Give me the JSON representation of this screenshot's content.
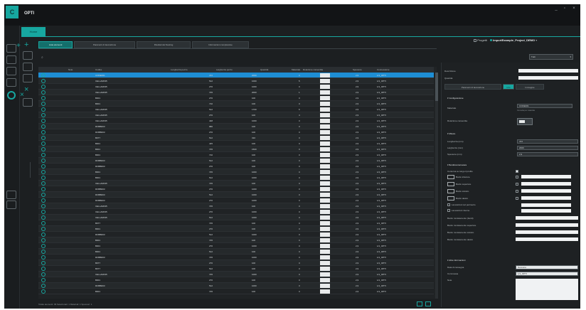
{
  "window": {
    "title": "OPTI",
    "logo_letter": "C",
    "controls": [
      "_",
      "▫",
      "×"
    ]
  },
  "ribbon": {
    "active_tab": "Home"
  },
  "project": {
    "checkbox_label": "Progetti",
    "name": "ImportExample_Project_DEMO"
  },
  "tabs": [
    {
      "label": "Lista elementi",
      "active": true
    },
    {
      "label": "Parametri di lavorazione",
      "active": false
    },
    {
      "label": "Risultati del Nesting",
      "active": false
    },
    {
      "label": "Informazioni complessive",
      "active": false
    }
  ],
  "filter": {
    "selected": "Tutti"
  },
  "table": {
    "columns": [
      "",
      "Note",
      "Codice",
      "Lunghezza pezzo",
      "Larghezza pezzo",
      "Quantità",
      "Materiale",
      "Rotazione consentita",
      "Spessore",
      "Connessione"
    ],
    "rows": [
      {
        "code": "CODE001",
        "len": "472",
        "wid": "2000",
        "qty": "3",
        "thk": "2,9",
        "conn": "1/1_OPTI"
      },
      {
        "code": "CELLAR035",
        "len": "512",
        "wid": "1000",
        "qty": "5",
        "thk": "2,9",
        "conn": "1/1_OPTI"
      },
      {
        "code": "CELLAR035",
        "len": "270",
        "wid": "1000",
        "qty": "3",
        "thk": "2,9",
        "conn": "1/1_OPTI"
      },
      {
        "code": "CELLAR035",
        "len": "745",
        "wid": "2000",
        "qty": "1",
        "thk": "2,9",
        "conn": "1/1_OPTI"
      },
      {
        "code": "B001",
        "len": "270",
        "wid": "100",
        "qty": "3",
        "thk": "2,9",
        "conn": "1/1_OPTI"
      },
      {
        "code": "B001",
        "len": "710",
        "wid": "100",
        "qty": "3",
        "thk": "2,9",
        "conn": "1/1_OPTI"
      },
      {
        "code": "CELLAR035",
        "len": "512",
        "wid": "1700",
        "qty": "6",
        "thk": "2,9",
        "conn": "1/1_OPTI"
      },
      {
        "code": "CELLAR035",
        "len": "270",
        "wid": "100",
        "qty": "4",
        "thk": "2,9",
        "conn": "1/1_OPTI"
      },
      {
        "code": "CELLAR035",
        "len": "448",
        "wid": "1000",
        "qty": "3",
        "thk": "2,9",
        "conn": "1/1_OPTI"
      },
      {
        "code": "ROBB003",
        "len": "980",
        "wid": "100",
        "qty": "3",
        "thk": "2,9",
        "conn": "1/1_OPTI"
      },
      {
        "code": "ROBB003",
        "len": "270",
        "wid": "100",
        "qty": "3",
        "thk": "2,9",
        "conn": "1/1_OPTI"
      },
      {
        "code": "B077",
        "len": "512",
        "wid": "310",
        "qty": "3",
        "thk": "2,9",
        "conn": "1/1_OPTI"
      },
      {
        "code": "B001",
        "len": "445",
        "wid": "100",
        "qty": "3",
        "thk": "2,9",
        "conn": "1/1_OPTI"
      },
      {
        "code": "B001",
        "len": "745",
        "wid": "1500",
        "qty": "3",
        "thk": "2,9",
        "conn": "1/1_OPTI"
      },
      {
        "code": "B001",
        "len": "710",
        "wid": "100",
        "qty": "3",
        "thk": "2,9",
        "conn": "1/1_OPTI"
      },
      {
        "code": "ROBB003",
        "len": "512",
        "wid": "100",
        "qty": "3",
        "thk": "2,9",
        "conn": "1/1_OPTI"
      },
      {
        "code": "ROBB003",
        "len": "270",
        "wid": "100",
        "qty": "3",
        "thk": "2,9",
        "conn": "1/1_OPTI"
      },
      {
        "code": "B001",
        "len": "745",
        "wid": "1000",
        "qty": "3",
        "thk": "2,9",
        "conn": "1/1_OPTI"
      },
      {
        "code": "B001",
        "len": "512",
        "wid": "1000",
        "qty": "3",
        "thk": "2,9",
        "conn": "1/1_OPTI"
      },
      {
        "code": "CELLAR035",
        "len": "745",
        "wid": "100",
        "qty": "3",
        "thk": "2,9",
        "conn": "1/1_OPTI"
      },
      {
        "code": "ROBB003",
        "len": "270",
        "wid": "1000",
        "qty": "3",
        "thk": "2,9",
        "conn": "1/1_OPTI"
      },
      {
        "code": "ROBB003",
        "len": "512",
        "wid": "1000",
        "qty": "3",
        "thk": "2,9",
        "conn": "1/1_OPTI"
      },
      {
        "code": "ROBB003",
        "len": "270",
        "wid": "1000",
        "qty": "3",
        "thk": "2,9",
        "conn": "1/1_OPTI"
      },
      {
        "code": "CELLAR035",
        "len": "745",
        "wid": "100",
        "qty": "3",
        "thk": "2,9",
        "conn": "1/1_OPTI"
      },
      {
        "code": "CELLAR035",
        "len": "270",
        "wid": "1000",
        "qty": "3",
        "thk": "2,9",
        "conn": "1/1_OPTI"
      },
      {
        "code": "CELLAR035",
        "len": "512",
        "wid": "1000",
        "qty": "3",
        "thk": "2,9",
        "conn": "1/1_OPTI"
      },
      {
        "code": "B077",
        "len": "745",
        "wid": "100",
        "qty": "3",
        "thk": "2,9",
        "conn": "1/1_OPTI"
      },
      {
        "code": "B001",
        "len": "270",
        "wid": "100",
        "qty": "3",
        "thk": "2,9",
        "conn": "1/1_OPTI"
      },
      {
        "code": "ROBB003",
        "len": "512",
        "wid": "1000",
        "qty": "3",
        "thk": "2,9",
        "conn": "1/1_OPTI"
      },
      {
        "code": "B001",
        "len": "745",
        "wid": "100",
        "qty": "3",
        "thk": "2,9",
        "conn": "1/1_OPTI"
      },
      {
        "code": "B001",
        "len": "270",
        "wid": "1000",
        "qty": "3",
        "thk": "2,9",
        "conn": "1/1_OPTI"
      },
      {
        "code": "B001",
        "len": "512",
        "wid": "100",
        "qty": "3",
        "thk": "2,9",
        "conn": "1/1_OPTI"
      },
      {
        "code": "ROBB003",
        "len": "745",
        "wid": "1000",
        "qty": "3",
        "thk": "2,9",
        "conn": "1/1_OPTI"
      },
      {
        "code": "B077",
        "len": "270",
        "wid": "100",
        "qty": "3",
        "thk": "2,9",
        "conn": "1/1_OPTI"
      },
      {
        "code": "B077",
        "len": "512",
        "wid": "100",
        "qty": "3",
        "thk": "2,9",
        "conn": "1/1_OPTI"
      },
      {
        "code": "CELLAR035",
        "len": "745",
        "wid": "1000",
        "qty": "3",
        "thk": "2,9",
        "conn": "1/1_OPTI"
      },
      {
        "code": "B001",
        "len": "270",
        "wid": "100",
        "qty": "3",
        "thk": "2,9",
        "conn": "1/1_OPTI"
      },
      {
        "code": "ROBB003",
        "len": "512",
        "wid": "1000",
        "qty": "3",
        "thk": "2,9",
        "conn": "1/1_OPTI"
      },
      {
        "code": "B001",
        "len": "745",
        "wid": "100",
        "qty": "3",
        "thk": "2,9",
        "conn": "1/1_OPTI"
      }
    ]
  },
  "status": {
    "text": "Totale elementi: 39   Selezionati: 1   Materiali: 1   Spessori: 1"
  },
  "panel": {
    "desc_label": "Descrizione",
    "qty_label": "Quantità",
    "tabs": [
      "Parametri di lavorazione",
      "Info",
      "Immagine"
    ],
    "sec_conf": "Configurazione",
    "materiale_label": "Materiale",
    "materiale_value": "CODE001",
    "materiale_sub": "Consulta per materiale",
    "rotation_label": "Rotazione consentita",
    "sec_misure": "Misure",
    "lunghezza_label": "Lunghezza (mm)",
    "lunghezza_value": "472",
    "larghezza_label": "Larghezza (mm)",
    "larghezza_value": "2000",
    "spessore_label": "Spessore (mm)",
    "spessore_value": "2,9",
    "sec_bordi": "Bordi/contornatura",
    "bordi_check_label": "Contorna su lungo il profilo",
    "bordi": [
      "Bordo inferiore",
      "Bordo superiore",
      "Bordo sinistro",
      "Bordo destro"
    ],
    "extra_checks": [
      "Lavorazioni sul perimetro",
      "Lavorazioni interne"
    ],
    "sec_params": [
      "Bordo mm/elemento (bordi)",
      "Bordo mm/elemento superiore",
      "Bordo mm/elemento sinistro",
      "Bordo mm/elemento destro"
    ],
    "sec_info": "Altre informazioni",
    "info_fields": [
      "Data di consegna",
      "Commessa",
      "Note"
    ],
    "info_values": [
      "Nessuna",
      "1/1_OPTI",
      ""
    ]
  }
}
